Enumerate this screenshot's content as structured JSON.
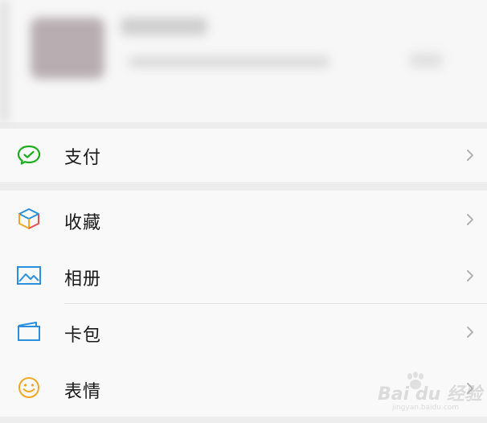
{
  "menu": {
    "pay": {
      "label": "支付",
      "icon": "wechat-pay-icon"
    },
    "items": [
      {
        "label": "收藏",
        "icon": "favorites-cube-icon"
      },
      {
        "label": "相册",
        "icon": "album-image-icon"
      },
      {
        "label": "卡包",
        "icon": "card-wallet-icon"
      },
      {
        "label": "表情",
        "icon": "sticker-smile-icon"
      }
    ]
  },
  "watermark": {
    "text": "Bai du 经验",
    "url": "jingyan.baidu.com"
  },
  "colors": {
    "pay_green": "#1aad19",
    "favorites_blue": "#2b8fe0",
    "favorites_orange": "#f5a623",
    "album_blue": "#2b8fe0",
    "card_blue": "#2b8fe0",
    "sticker_orange": "#f5a623",
    "chevron": "#b2b2b2"
  }
}
